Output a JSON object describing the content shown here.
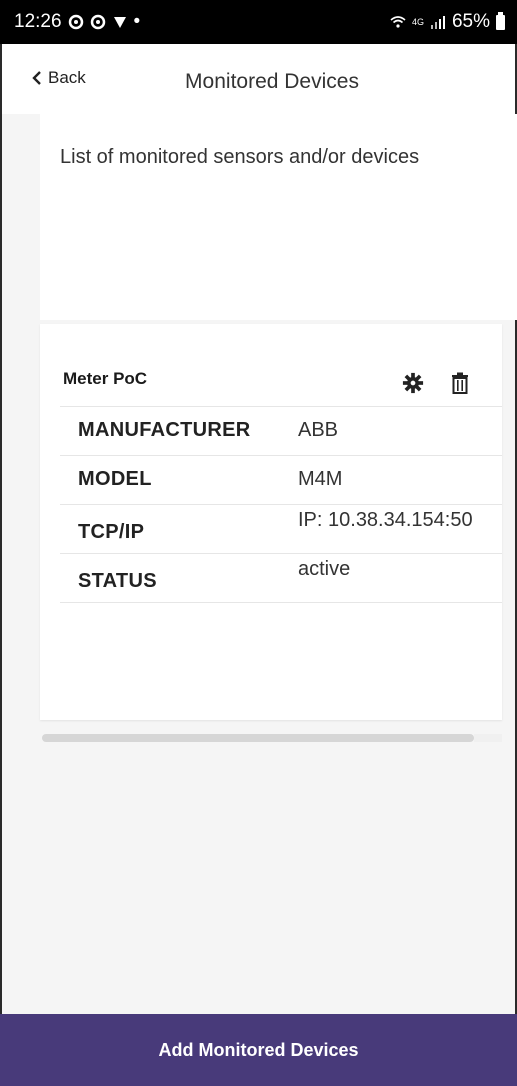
{
  "status_bar": {
    "time": "12:26",
    "extra": "•",
    "network": "4G",
    "battery": "65%"
  },
  "app_bar": {
    "back_label": "Back",
    "title": "Monitored Devices"
  },
  "main": {
    "description": "List of monitored sensors and/or devices",
    "device": {
      "name": "Meter PoC",
      "properties": [
        {
          "label": "MANUFACTURER",
          "value": "ABB"
        },
        {
          "label": "MODEL",
          "value": "M4M"
        },
        {
          "label": "TCP/IP",
          "value": "IP: 10.38.34.154:50"
        },
        {
          "label": "STATUS",
          "value": "active"
        }
      ]
    }
  },
  "bottom_bar": {
    "button_label": "Add Monitored Devices"
  },
  "colors": {
    "accent": "#483a7a",
    "status_bar": "#000000",
    "content_bg": "#f5f5f5"
  },
  "icons": {
    "back": "chevron-left-icon",
    "settings": "gear-icon",
    "delete": "trash-icon"
  }
}
